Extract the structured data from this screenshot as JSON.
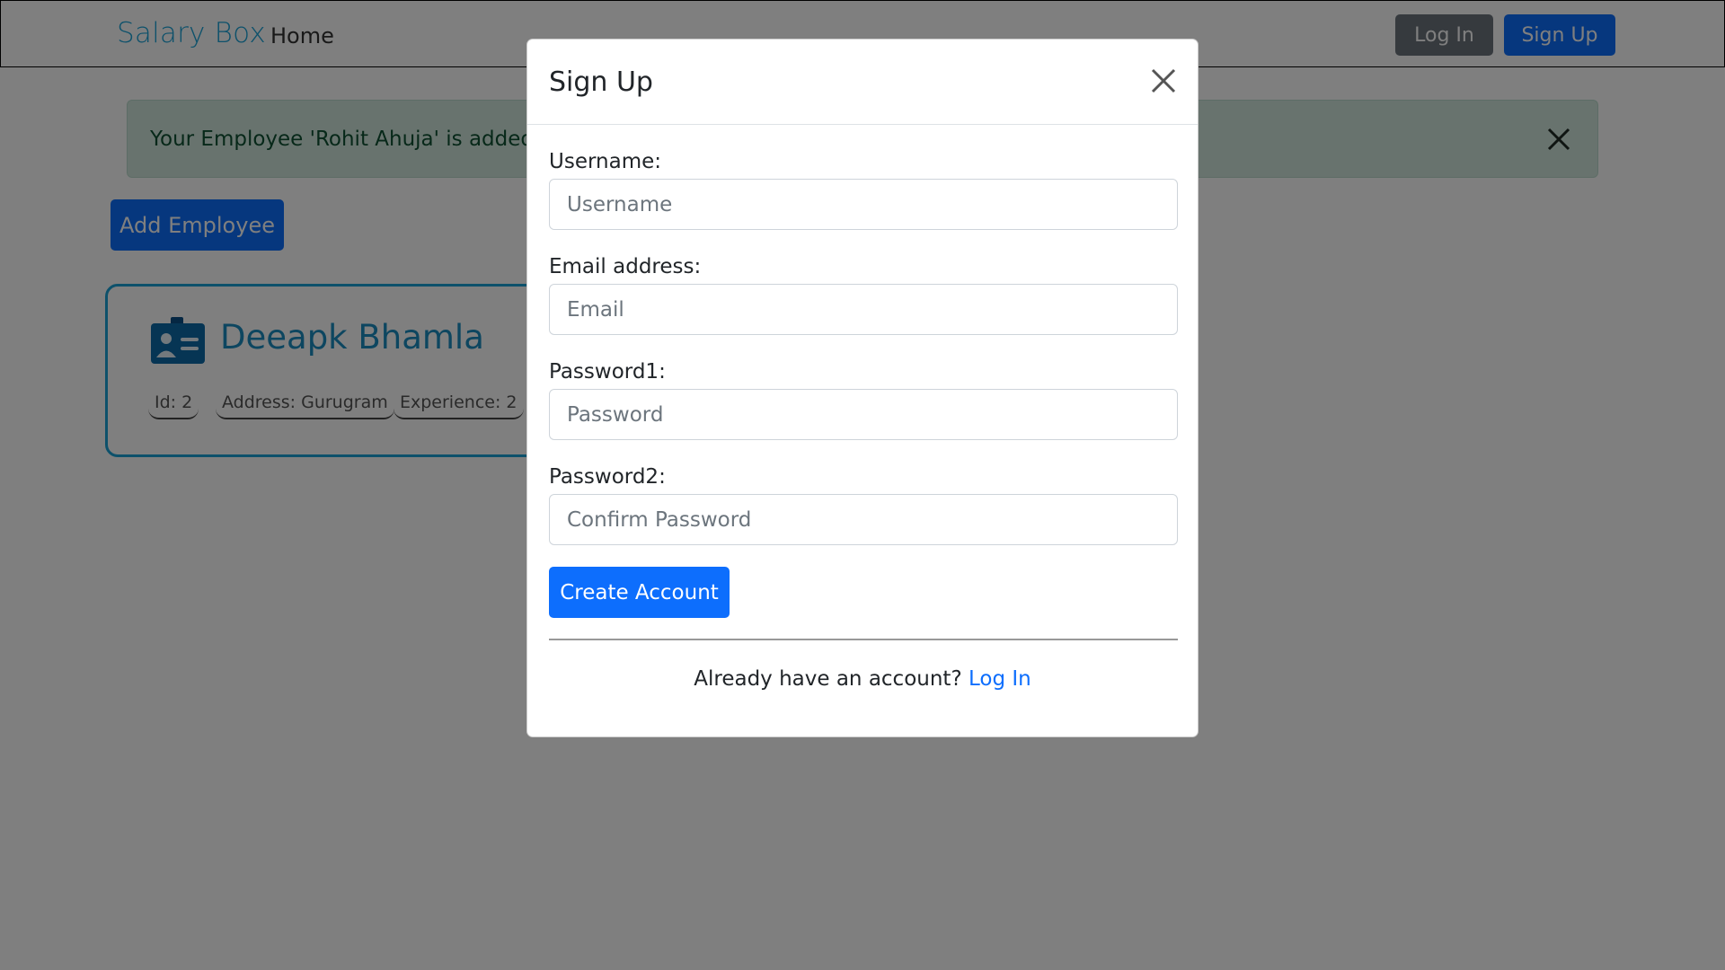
{
  "navbar": {
    "brand": "Salary Box",
    "home": "Home",
    "login": "Log In",
    "signup": "Sign Up"
  },
  "alert": {
    "message": "Your Employee 'Rohit Ahuja' is added successfully"
  },
  "actions": {
    "add_employee": "Add Employee"
  },
  "employee": {
    "name": "Deeapk Bhamla",
    "id": "Id: 2",
    "address": "Address: Gurugram",
    "experience": "Experience: 2"
  },
  "modal": {
    "title": "Sign Up",
    "username_label": "Username:",
    "username_placeholder": "Username",
    "email_label": "Email address:",
    "email_placeholder": "Email",
    "password1_label": "Password1:",
    "password1_placeholder": "Password",
    "password2_label": "Password2:",
    "password2_placeholder": "Confirm Password",
    "create_button": "Create Account",
    "footer_text": "Already have an account?",
    "footer_link": "Log In"
  },
  "colors": {
    "primary": "#0d6efd",
    "secondary": "#6c757d",
    "brand": "#1ba2d6",
    "alert_bg": "#d1e7dd"
  },
  "icons": {
    "card_icon": "id-card-icon",
    "alert_close": "close-icon",
    "modal_close": "close-icon"
  }
}
